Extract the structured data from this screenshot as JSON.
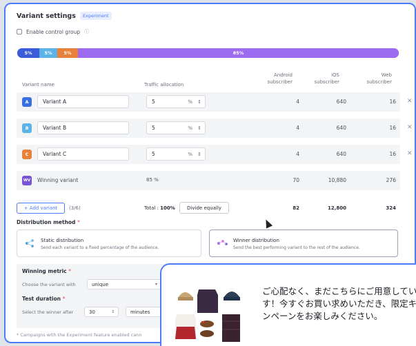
{
  "panel": {
    "title": "Variant settings",
    "badge": "Experiment",
    "control_group_label": "Enable control group",
    "info_icon": "info-icon"
  },
  "traffic_bar": {
    "segments": [
      {
        "label": "5%",
        "value": 5,
        "color": "#3b5bd9"
      },
      {
        "label": "5%",
        "value": 5,
        "color": "#5bb3e8"
      },
      {
        "label": "5%",
        "value": 5,
        "color": "#e8813a"
      },
      {
        "label": "85%",
        "value": 85,
        "color": "#9c6bf0"
      }
    ]
  },
  "table": {
    "headers": {
      "variant_name": "Variant name",
      "traffic": "Traffic allocation",
      "android": [
        "Android",
        "subscriber"
      ],
      "ios": [
        "iOS",
        "subscriber"
      ],
      "web": [
        "Web",
        "subscriber"
      ]
    },
    "variants": [
      {
        "badge": "A",
        "color": "#3b6fe0",
        "name": "Variant A",
        "pct": "5",
        "unit": "%",
        "android": "4",
        "ios": "640",
        "web": "16"
      },
      {
        "badge": "B",
        "color": "#5bb3e8",
        "name": "Variant B",
        "pct": "5",
        "unit": "%",
        "android": "4",
        "ios": "640",
        "web": "16"
      },
      {
        "badge": "C",
        "color": "#e8813a",
        "name": "Variant C",
        "pct": "5",
        "unit": "%",
        "android": "4",
        "ios": "640",
        "web": "16"
      }
    ],
    "winning": {
      "badge": "WV",
      "color": "#7a52d6",
      "name": "Winning variant",
      "pct": "85 %",
      "android": "70",
      "ios": "10,880",
      "web": "276"
    },
    "add_button": "+ Add variant",
    "count": "(3/6)",
    "total_label": "Total : ",
    "total_value": "100%",
    "divide_button": "Divide equally",
    "totals": {
      "android": "82",
      "ios": "12,800",
      "web": "324"
    }
  },
  "distribution": {
    "label": "Distribution method",
    "required": "*",
    "static": {
      "title": "Static distribution",
      "desc": "Send each variant to a fixed percentage of the audience."
    },
    "winner": {
      "title": "Winner distribution",
      "desc": "Send the best performing variant to the rest of the audience."
    }
  },
  "winning_metric": {
    "label": "Winning metric",
    "required": "*",
    "choose_label": "Choose the variant with",
    "value": "unique"
  },
  "test_duration": {
    "label": "Test duration",
    "required": "*",
    "select_label": "Select the winner after",
    "number": "30",
    "unit": "minutes"
  },
  "footnote": "* Campaigns with the Experiment feature enabled cann",
  "popup": {
    "message": "ご心配なく、まだこちらにご用意しています！今すぐお買い求めいただき、限定キャンペーンをお楽しみください。"
  }
}
